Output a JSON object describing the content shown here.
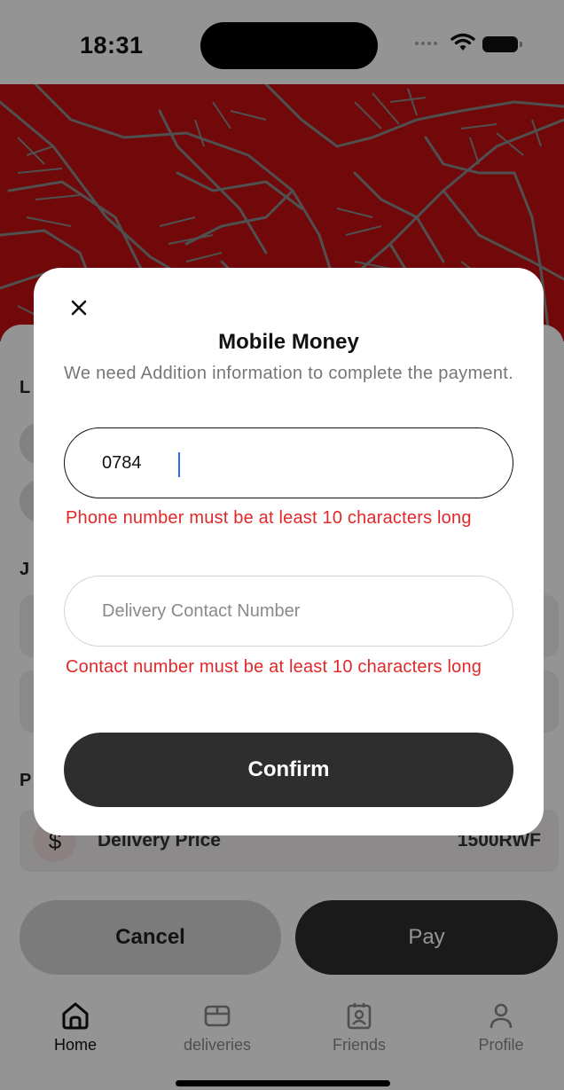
{
  "status_bar": {
    "time": "18:31"
  },
  "map": {
    "background_color": "#c30f10",
    "road_color": "#8a8a8a"
  },
  "sheet": {
    "sections": [
      "L",
      "J",
      "P"
    ],
    "price": {
      "icon": "dollar-icon",
      "label": "Delivery Price",
      "value": "1500RWF"
    },
    "buttons": {
      "cancel": "Cancel",
      "pay": "Pay"
    }
  },
  "tabbar": {
    "items": [
      {
        "label": "Home",
        "icon": "home-icon",
        "active": true
      },
      {
        "label": "deliveries",
        "icon": "package-icon",
        "active": false
      },
      {
        "label": "Friends",
        "icon": "contact-card-icon",
        "active": false
      },
      {
        "label": "Profile",
        "icon": "user-icon",
        "active": false
      }
    ]
  },
  "modal": {
    "title": "Mobile Money",
    "subtitle": "We need Addition information to complete the payment.",
    "phone_value": "0784",
    "phone_error": "Phone number must be at least 10 characters long",
    "contact_placeholder": "Delivery Contact Number",
    "contact_value": "",
    "contact_error": "Contact number must be at least 10 characters long",
    "confirm_label": "Confirm",
    "close_icon": "close-icon"
  },
  "colors": {
    "error": "#e0282a",
    "button_dark": "#2e2e2e",
    "map_red": "#c30f10",
    "caret": "#2f6df6"
  }
}
